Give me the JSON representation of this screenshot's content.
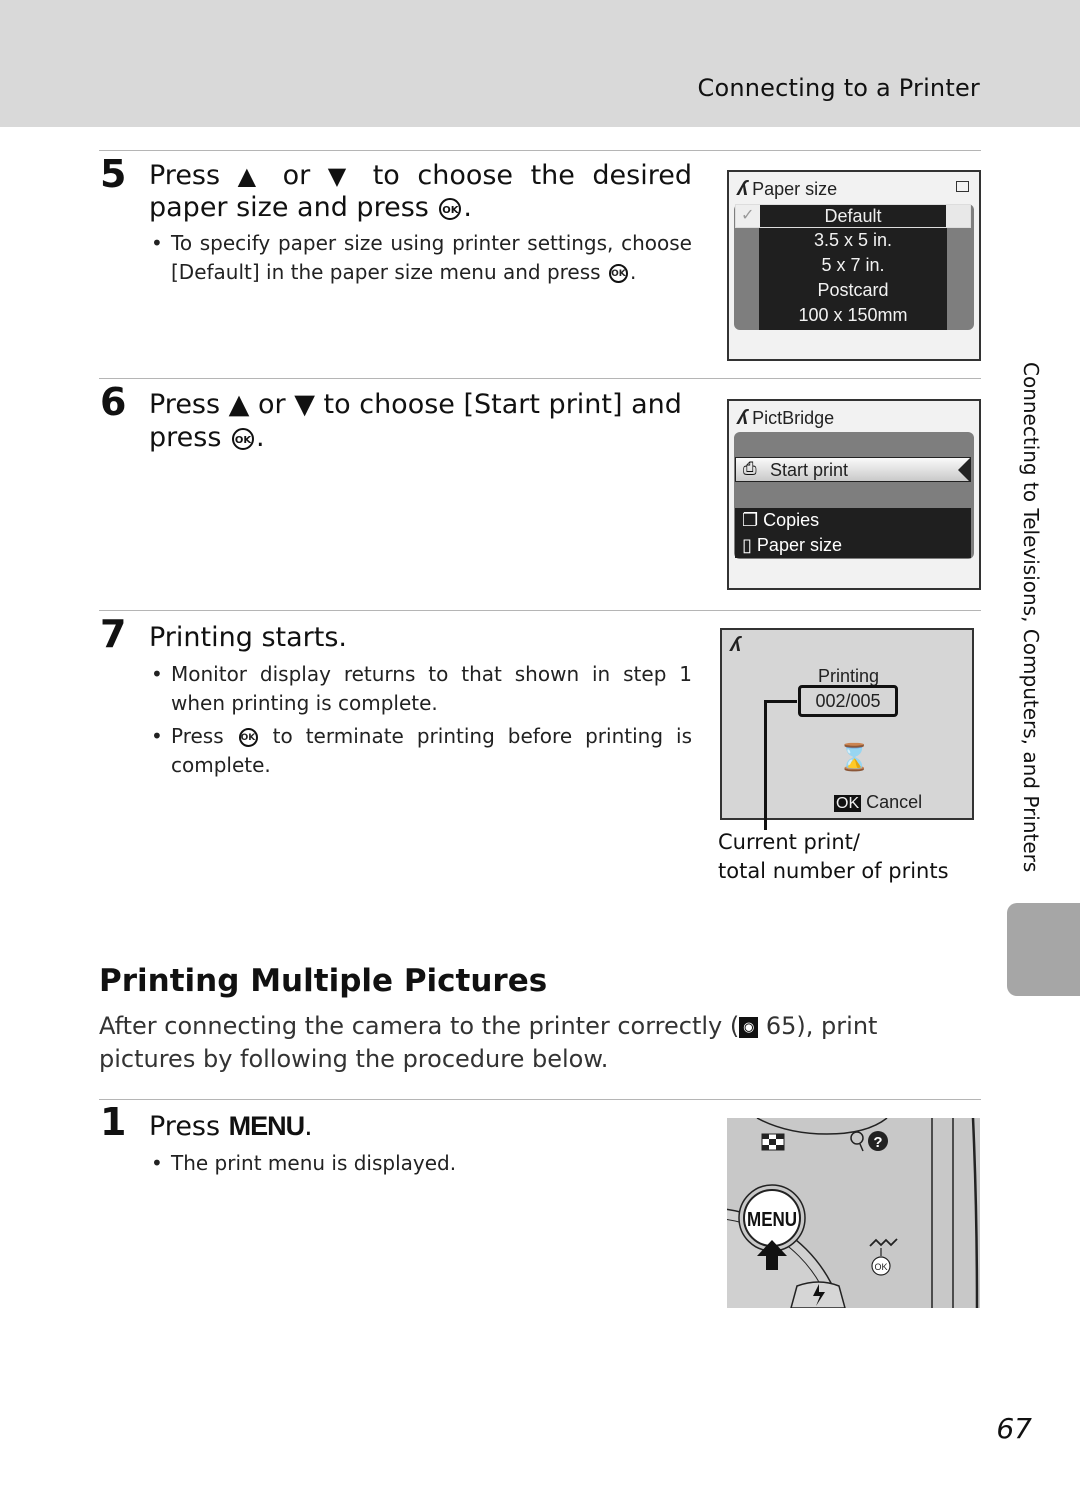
{
  "header": {
    "section": "Connecting to a Printer"
  },
  "side_tab": {
    "label": "Connecting to Televisions, Computers, and Printers"
  },
  "steps_top": [
    {
      "number": "5",
      "title_parts": [
        "Press",
        "▲",
        "or",
        "▼",
        "to choose the desired"
      ],
      "title_line2": "paper size and press",
      "bullets": [
        {
          "line1": "To specify paper size using printer settings, choose",
          "line2": "[Default] in the paper size menu and press"
        }
      ],
      "screen": {
        "title": "Paper size",
        "icon": "pictbridge-icon",
        "options": [
          "Default",
          "3.5 x 5 in.",
          "5 x 7 in.",
          "Postcard",
          "100 x 150mm"
        ],
        "selected": "Default"
      }
    },
    {
      "number": "6",
      "title_line1": "Press ▲ or ▼ to choose [Start print] and",
      "title_line2": "press",
      "screen": {
        "title": "PictBridge",
        "items": [
          "Start print",
          "Copies",
          "Paper size"
        ],
        "selected": "Start print"
      }
    },
    {
      "number": "7",
      "title": "Printing starts.",
      "bullets": [
        {
          "line1": "Monitor display returns to that shown in step 1",
          "line2": "when printing is complete."
        },
        {
          "line1_pre": "Press",
          "line1_post": "to terminate printing before printing is",
          "line2": "complete."
        }
      ],
      "screen": {
        "status": "Printing",
        "counter": "002/005",
        "cancel_key": "OK",
        "cancel_label": "Cancel"
      },
      "callout": {
        "line1": "Current print/",
        "line2": "total number of prints"
      }
    }
  ],
  "section": {
    "title": "Printing Multiple Pictures",
    "intro_pre": "After connecting the camera to the printer correctly (",
    "intro_ref": "65",
    "intro_post": "), print pictures by following the procedure below."
  },
  "step1": {
    "number": "1",
    "title_pre": "Press",
    "title_key": "MENU",
    "bullet": "The print menu is displayed.",
    "camera": {
      "button_label": "MENU",
      "ok_label": "OK"
    }
  },
  "ok_glyph": "OK",
  "page_number": "67"
}
